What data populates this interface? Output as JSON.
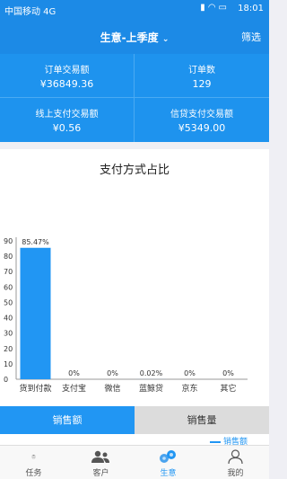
{
  "status_bar": {
    "carrier": "中国移动 4G",
    "time": "18:01"
  },
  "header": {
    "title": "生意-上季度",
    "filter_label": "筛选"
  },
  "stats": [
    {
      "label": "订单交易额",
      "value": "¥36849.36"
    },
    {
      "label": "订单数",
      "value": "129"
    },
    {
      "label": "线上支付交易额",
      "value": "¥0.56"
    },
    {
      "label": "信贷支付交易额",
      "value": "¥5349.00"
    }
  ],
  "chart_data": {
    "type": "bar",
    "title": "支付方式占比",
    "categories": [
      "货到付款",
      "支付宝",
      "微信",
      "蓝鲸贷",
      "京东",
      "其它"
    ],
    "values": [
      85.47,
      0,
      0,
      0.02,
      0,
      0
    ],
    "value_labels": [
      "85.47%",
      "0%",
      "0%",
      "0.02%",
      "0%",
      "0%"
    ],
    "y_ticks": [
      "0",
      "10",
      "20",
      "30",
      "40",
      "50",
      "60",
      "70",
      "80",
      "90"
    ],
    "ylim": [
      0,
      90
    ],
    "bar_color": "#2196f3"
  },
  "toggle": {
    "sales_amount": "销售额",
    "sales_volume": "销售量"
  },
  "legend": {
    "label": "销售额"
  },
  "tabs": [
    {
      "label": "任务",
      "icon": "clipboard-icon"
    },
    {
      "label": "客户",
      "icon": "users-icon"
    },
    {
      "label": "生意",
      "icon": "coins-icon"
    },
    {
      "label": "我的",
      "icon": "person-icon"
    }
  ],
  "colors": {
    "primary": "#1c8ae6",
    "accent": "#2196f3"
  }
}
